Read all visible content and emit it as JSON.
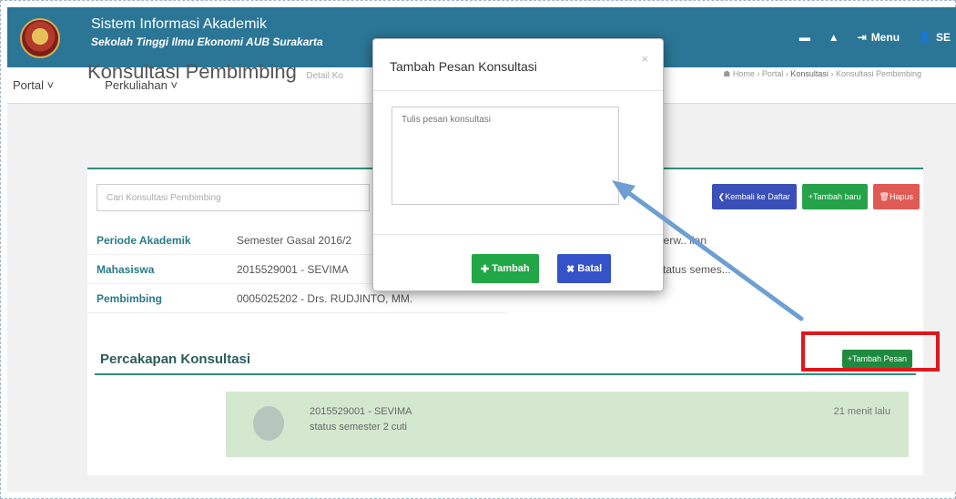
{
  "header": {
    "title": "Sistem Informasi Akademik",
    "subtitle": "Sekolah Tinggi Ilmu Ekonomi AUB Surakarta",
    "menu_label": "Menu",
    "user_label": "SE"
  },
  "nav": {
    "portal": "Portal ˅",
    "perkuliahan": "Perkuliahan ˅"
  },
  "page": {
    "title": "Konsultasi Pembimbing",
    "subtitle": "Detail Ko",
    "breadcrumb": [
      "Home",
      "Portal",
      "Konsultasi",
      "Konsultasi Pembimbing"
    ]
  },
  "toolbar": {
    "search_placeholder": "Cari Konsultasi Pembimbing",
    "back_label": "❮Kembali ke Daftar",
    "new_label": "+Tambah baru",
    "delete_label": "Hapus"
  },
  "info": {
    "periode_label": "Periode Akademik",
    "periode_value": "Semester Gasal 2016/2",
    "mahasiswa_label": "Mahasiswa",
    "mahasiswa_value": "2015529001 - SEVIMA",
    "pembimbing_label": "Pembimbing",
    "pembimbing_value": "0005025202 - Drs. RUDJINTO, MM.",
    "right_1": "perw.. lian",
    "right_2": "status semes..."
  },
  "conversation": {
    "title": "Percakapan Konsultasi",
    "add_button": "+Tambah Pesan",
    "message_author": "2015529001 - SEVIMA",
    "message_text": "status semester 2 cuti",
    "message_time": "21 menit lalu"
  },
  "modal": {
    "title": "Tambah Pesan Konsultasi",
    "close": "×",
    "textarea_placeholder": "Tulis pesan konsultasi",
    "add_button": "Tambah",
    "cancel_button": "Batal"
  },
  "colors": {
    "header": "#2b7696",
    "accent": "#2f8f7a",
    "highlight_box": "#e0161b",
    "arrow": "#6e9fd2"
  }
}
